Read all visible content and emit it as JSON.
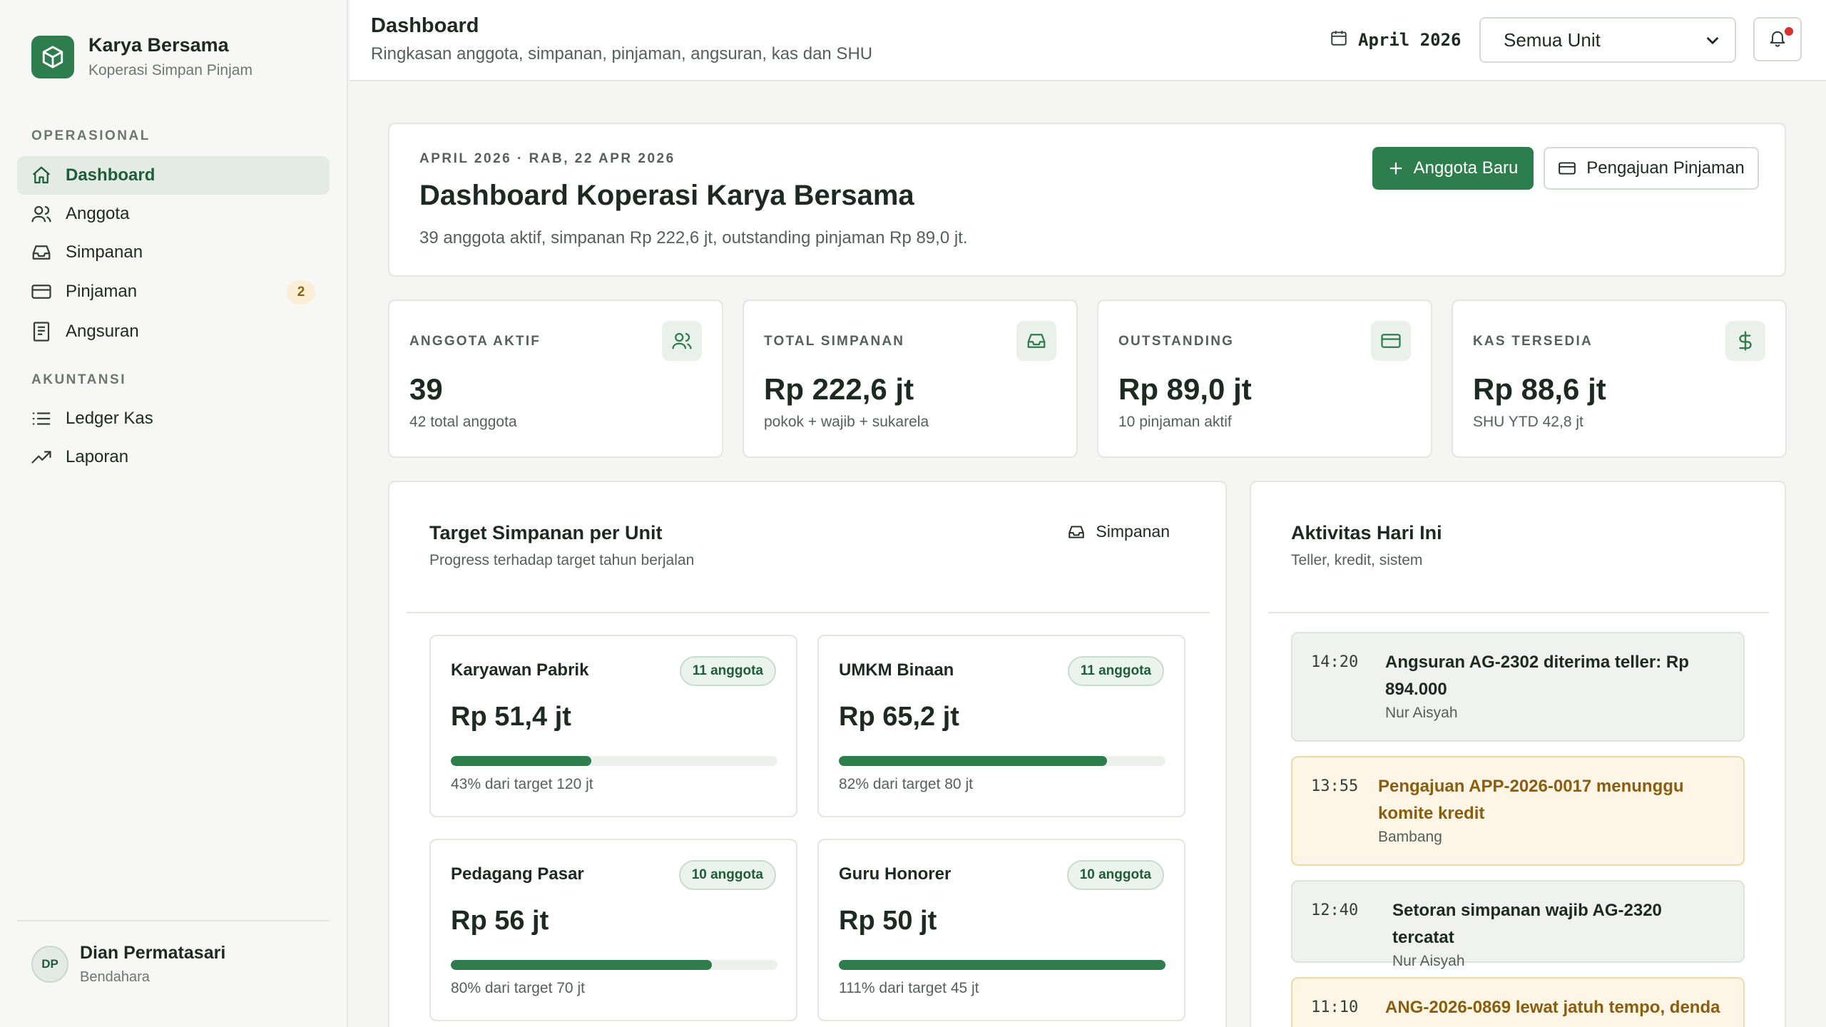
{
  "brand": {
    "name": "Karya Bersama",
    "subtitle": "Koperasi Simpan Pinjam"
  },
  "nav": {
    "section_operasional": "OPERASIONAL",
    "section_akuntansi": "AKUNTANSI",
    "items": [
      {
        "label": "Dashboard",
        "icon": "home-icon",
        "active": true
      },
      {
        "label": "Anggota",
        "icon": "users-icon"
      },
      {
        "label": "Simpanan",
        "icon": "inbox-icon"
      },
      {
        "label": "Pinjaman",
        "icon": "credit-card-icon",
        "badge": "2"
      },
      {
        "label": "Angsuran",
        "icon": "receipt-icon"
      },
      {
        "label": "Ledger Kas",
        "icon": "list-icon"
      },
      {
        "label": "Laporan",
        "icon": "trending-up-icon"
      }
    ]
  },
  "user": {
    "initials": "DP",
    "name": "Dian Permatasari",
    "role": "Bendahara"
  },
  "header": {
    "title": "Dashboard",
    "subtitle": "Ringkasan anggota, simpanan, pinjaman, angsuran, kas dan SHU",
    "period": "April 2026",
    "unit_selected": "Semua Unit"
  },
  "hero": {
    "eyebrow": "APRIL 2026 · RAB, 22 APR 2026",
    "title": "Dashboard Koperasi Karya Bersama",
    "description": "39 anggota aktif, simpanan Rp 222,6 jt, outstanding pinjaman Rp 89,0 jt.",
    "btn_new_member": "Anggota Baru",
    "btn_loan": "Pengajuan Pinjaman"
  },
  "stats": [
    {
      "label": "ANGGOTA AKTIF",
      "value": "39",
      "sub": "42 total anggota",
      "icon": "users-icon"
    },
    {
      "label": "TOTAL SIMPANAN",
      "value": "Rp 222,6 jt",
      "sub": "pokok + wajib + sukarela",
      "icon": "inbox-icon"
    },
    {
      "label": "OUTSTANDING",
      "value": "Rp 89,0 jt",
      "sub": "10 pinjaman aktif",
      "icon": "credit-card-icon"
    },
    {
      "label": "KAS TERSEDIA",
      "value": "Rp 88,6 jt",
      "sub": "SHU YTD 42,8 jt",
      "icon": "dollar-icon"
    }
  ],
  "target": {
    "title": "Target Simpanan per Unit",
    "subtitle": "Progress terhadap target tahun berjalan",
    "link": "Simpanan",
    "units": [
      {
        "name": "Karyawan Pabrik",
        "badge": "11 anggota",
        "value": "Rp 51,4 jt",
        "progress": 43,
        "note": "43% dari target 120 jt"
      },
      {
        "name": "UMKM Binaan",
        "badge": "11 anggota",
        "value": "Rp 65,2 jt",
        "progress": 82,
        "note": "82% dari target 80 jt"
      },
      {
        "name": "Pedagang Pasar",
        "badge": "10 anggota",
        "value": "Rp 56 jt",
        "progress": 80,
        "note": "80% dari target 70 jt"
      },
      {
        "name": "Guru Honorer",
        "badge": "10 anggota",
        "value": "Rp 50 jt",
        "progress": 100,
        "note": "111% dari target 45 jt"
      }
    ]
  },
  "activity": {
    "title": "Aktivitas Hari Ini",
    "subtitle": "Teller, kredit, sistem",
    "items": [
      {
        "time": "14:20",
        "title": "Angsuran AG-2302 diterima teller: Rp 894.000",
        "who": "Nur Aisyah",
        "warn": false
      },
      {
        "time": "13:55",
        "title": "Pengajuan APP-2026-0017 menunggu komite kredit",
        "who": "Bambang",
        "warn": true
      },
      {
        "time": "12:40",
        "title": "Setoran simpanan wajib AG-2320 tercatat",
        "who": "Nur Aisyah",
        "warn": false
      },
      {
        "time": "11:10",
        "title": "ANG-2026-0869 lewat jatuh tempo, denda",
        "who": "",
        "warn": true
      }
    ]
  },
  "colors": {
    "accent": "#2e7d4c",
    "warning": "#8a5d0f",
    "notification": "#d93030"
  }
}
